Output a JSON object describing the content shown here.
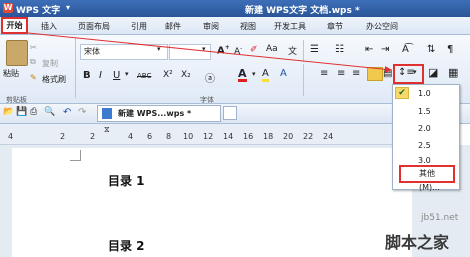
{
  "titlebar": {
    "app_name": "WPS 文字",
    "doc_title": "新建 WPS文字 文档.wps *"
  },
  "menu": [
    "开始",
    "插入",
    "页面布局",
    "引用",
    "邮件",
    "审阅",
    "视图",
    "开发工具",
    "章节",
    "办公空间"
  ],
  "ribbon": {
    "font_name": "宋体",
    "paste_label": "粘贴",
    "copy_label": "复制",
    "format_painter_label": "格式刷",
    "clipboard_group": "剪贴板",
    "font_group": "字体",
    "bold": "B",
    "italic": "I",
    "underline": "U",
    "strike": "ABC",
    "superscript": "X²",
    "subscript": "X₂",
    "font_color": "A",
    "highlight": "A",
    "aa": "Aa"
  },
  "quickbar": {
    "doc_tab": "新建 WPS...wps *"
  },
  "ruler": {
    "ticks": [
      "4",
      "2",
      "2",
      "4",
      "6",
      "8",
      "10",
      "12",
      "14",
      "16",
      "18",
      "20",
      "22",
      "24"
    ]
  },
  "document": {
    "heading1": "目录 1",
    "heading2": "目录 2"
  },
  "line_spacing_menu": {
    "options": [
      "1.0",
      "1.5",
      "2.0",
      "2.5",
      "3.0"
    ],
    "selected": "1.0",
    "other": "其他(M)..."
  },
  "watermark": {
    "site": "jb51.net",
    "name": "脚本之家"
  },
  "colors": {
    "accent_red": "#e03030",
    "titlebar": "#2f5ea4"
  }
}
